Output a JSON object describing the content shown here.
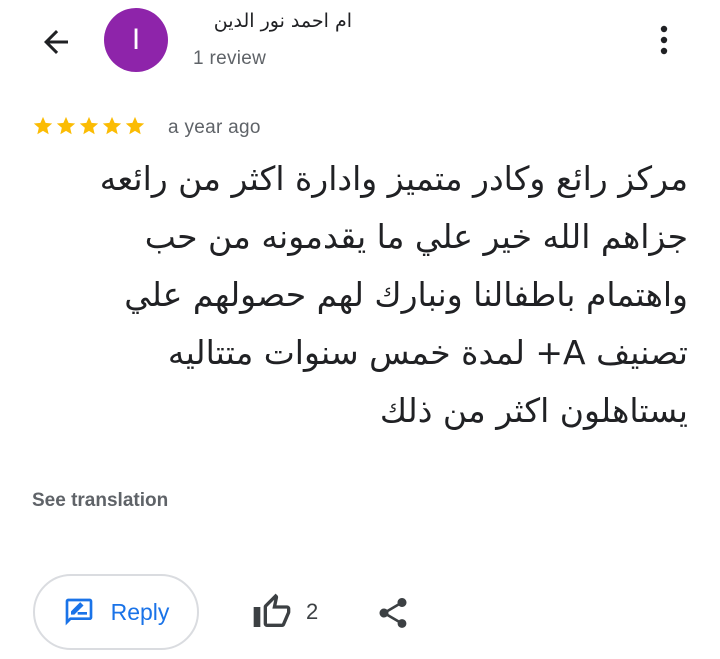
{
  "header": {
    "back_icon": "arrow-back-icon",
    "avatar_letter": "I",
    "avatar_color": "#8e24aa",
    "author_name": "ام احمد نور الدين",
    "review_count": "1 review",
    "more_icon": "more-vert-icon"
  },
  "review": {
    "rating": 5,
    "max_rating": 5,
    "star_color": "#fbbc04",
    "date": "a year ago",
    "lines": [
      "مركز رائع وكادر متميز وادارة اكثر من رائعه",
      "جزاهم الله خير علي ما يقدمونه من حب",
      "واهتمام باطفالنا ونبارك لهم حصولهم علي",
      "تصنيف A+ لمدة خمس سنوات متتاليه",
      "يستاهلون اكثر من ذلك"
    ],
    "see_translation": "See translation"
  },
  "actions": {
    "reply_label": "Reply",
    "reply_icon": "rate-review-icon",
    "like_icon": "thumb-up-icon",
    "like_count": "2",
    "share_icon": "share-icon",
    "accent_color": "#1a73e8"
  }
}
